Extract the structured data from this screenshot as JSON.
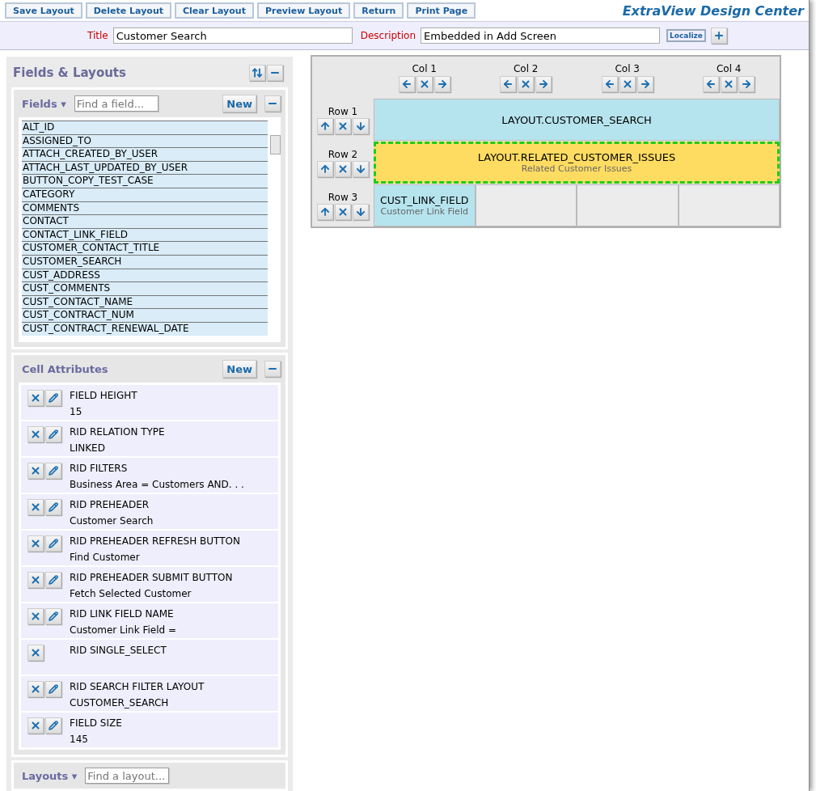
{
  "toolbar": {
    "buttons": [
      "Save Layout",
      "Delete Layout",
      "Clear Layout",
      "Preview Layout",
      "Return",
      "Print Page"
    ],
    "app_title": "ExtraView Design Center"
  },
  "header": {
    "title_label": "Title",
    "title_value": "Customer Search",
    "description_label": "Description",
    "description_value": "Embedded in Add Screen",
    "localize_button": "Localize"
  },
  "sidebar": {
    "title": "Fields & Layouts",
    "fields": {
      "label": "Fields ▾",
      "search_placeholder": "Find a field...",
      "new_button": "New",
      "items": [
        "ALT_ID",
        "ASSIGNED_TO",
        "ATTACH_CREATED_BY_USER",
        "ATTACH_LAST_UPDATED_BY_USER",
        "BUTTON_COPY_TEST_CASE",
        "CATEGORY",
        "COMMENTS",
        "CONTACT",
        "CONTACT_LINK_FIELD",
        "CUSTOMER_CONTACT_TITLE",
        "CUSTOMER_SEARCH",
        "CUST_ADDRESS",
        "CUST_COMMENTS",
        "CUST_CONTACT_NAME",
        "CUST_CONTRACT_NUM",
        "CUST_CONTRACT_RENEWAL_DATE"
      ]
    },
    "cell_attributes": {
      "title": "Cell Attributes",
      "new_button": "New",
      "items": [
        {
          "name": "FIELD HEIGHT",
          "value": "15",
          "editable": true
        },
        {
          "name": "RID RELATION TYPE",
          "value": "LINKED",
          "editable": true
        },
        {
          "name": "RID FILTERS",
          "value": "Business Area = Customers AND. . .",
          "editable": true
        },
        {
          "name": "RID PREHEADER",
          "value": "Customer Search",
          "editable": true
        },
        {
          "name": "RID PREHEADER REFRESH BUTTON",
          "value": "Find Customer",
          "editable": true
        },
        {
          "name": "RID PREHEADER SUBMIT BUTTON",
          "value": "Fetch Selected Customer",
          "editable": true
        },
        {
          "name": "RID LINK FIELD NAME",
          "value": "Customer Link Field  =",
          "editable": true
        },
        {
          "name": "RID SINGLE_SELECT",
          "editable": false
        },
        {
          "name": "RID SEARCH FILTER LAYOUT",
          "value": "CUSTOMER_SEARCH",
          "editable": true
        },
        {
          "name": "FIELD SIZE",
          "value": "145",
          "editable": true
        }
      ]
    },
    "layouts": {
      "label": "Layouts ▾",
      "search_placeholder": "Find a layout..."
    }
  },
  "design_grid": {
    "columns": [
      "Col 1",
      "Col 2",
      "Col 3",
      "Col 4"
    ],
    "rows": [
      {
        "label": "Row 1",
        "cells": [
          {
            "kind": "layout",
            "name": "LAYOUT.CUSTOMER_SEARCH",
            "selected": false
          }
        ]
      },
      {
        "label": "Row 2",
        "cells": [
          {
            "kind": "layout",
            "name": "LAYOUT.RELATED_CUSTOMER_ISSUES",
            "caption": "Related Customer Issues",
            "selected": true
          }
        ]
      },
      {
        "label": "Row 3",
        "cells": [
          {
            "kind": "field",
            "name": "CUST_LINK_FIELD",
            "caption": "Customer Link Field",
            "selected": false
          },
          {
            "kind": "empty",
            "selected": false
          },
          {
            "kind": "empty",
            "selected": false
          },
          {
            "kind": "empty",
            "selected": false
          }
        ]
      }
    ]
  }
}
